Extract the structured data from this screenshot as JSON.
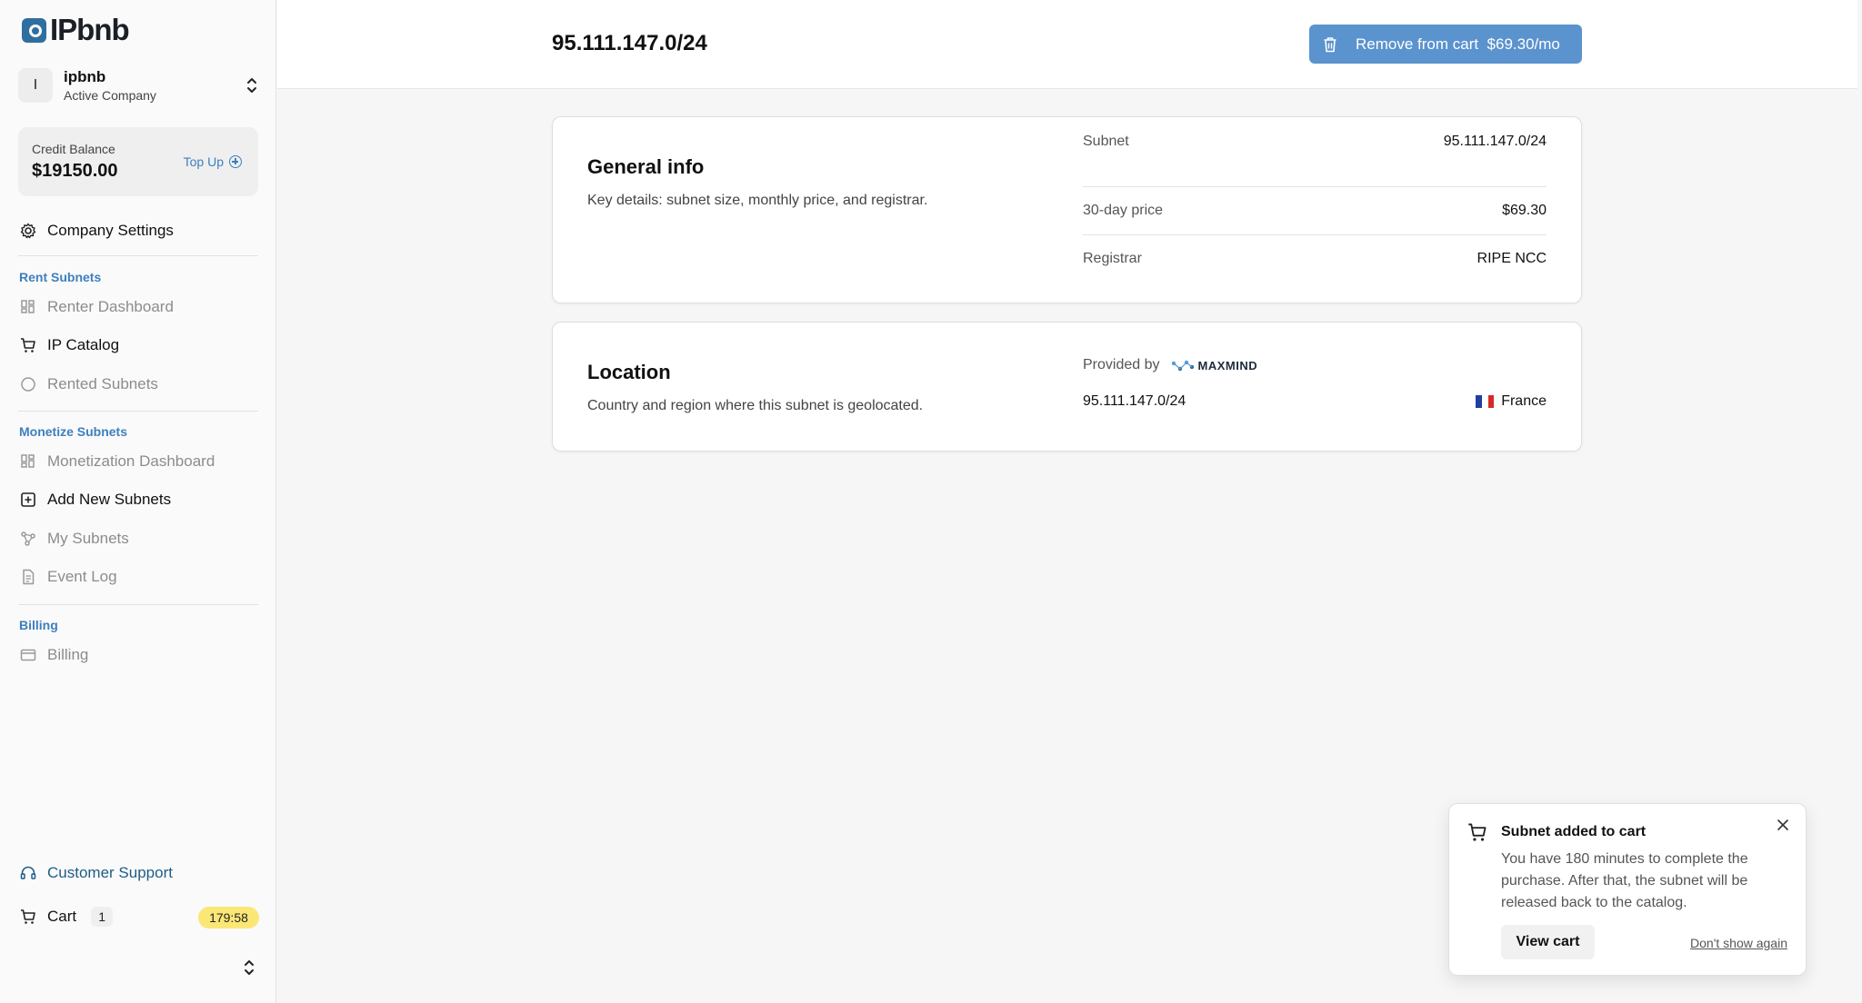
{
  "brand": {
    "name": "IPbnb"
  },
  "company": {
    "initial": "I",
    "name": "ipbnb",
    "subtitle": "Active Company"
  },
  "credit": {
    "label": "Credit Balance",
    "value": "$19150.00",
    "topup_label": "Top Up"
  },
  "sidebar": {
    "company_settings": "Company Settings",
    "sections": {
      "rent": "Rent Subnets",
      "monetize": "Monetize Subnets",
      "billing": "Billing"
    },
    "items": {
      "renter_dashboard": "Renter Dashboard",
      "ip_catalog": "IP Catalog",
      "rented_subnets": "Rented Subnets",
      "monetization_dashboard": "Monetization Dashboard",
      "add_new_subnets": "Add New Subnets",
      "my_subnets": "My Subnets",
      "event_log": "Event Log",
      "billing": "Billing"
    },
    "customer_support": "Customer Support",
    "cart": {
      "label": "Cart",
      "count": "1",
      "timer": "179:58"
    }
  },
  "header": {
    "title": "95.111.147.0/24",
    "remove_button": "Remove from cart  $69.30/mo"
  },
  "general_info": {
    "title": "General info",
    "description": "Key details: subnet size, monthly price, and registrar.",
    "rows": [
      {
        "key": "Subnet",
        "value": "95.111.147.0/24"
      },
      {
        "key": "30-day price",
        "value": "$69.30"
      },
      {
        "key": "Registrar",
        "value": "RIPE NCC"
      }
    ]
  },
  "location": {
    "title": "Location",
    "description": "Country and region where this subnet is geolocated.",
    "provided_by": "Provided by",
    "provider": "MAXMIND",
    "subnet": "95.111.147.0/24",
    "country": "France"
  },
  "toast": {
    "title": "Subnet added to cart",
    "body": "You have 180 minutes to complete the purchase. After that, the subnet will be released back to the catalog.",
    "view_cart": "View cart",
    "dont_show": "Don't show again"
  },
  "colors": {
    "accent": "#3d7fbe",
    "button": "#5b93ce",
    "timer": "#fbe776"
  }
}
